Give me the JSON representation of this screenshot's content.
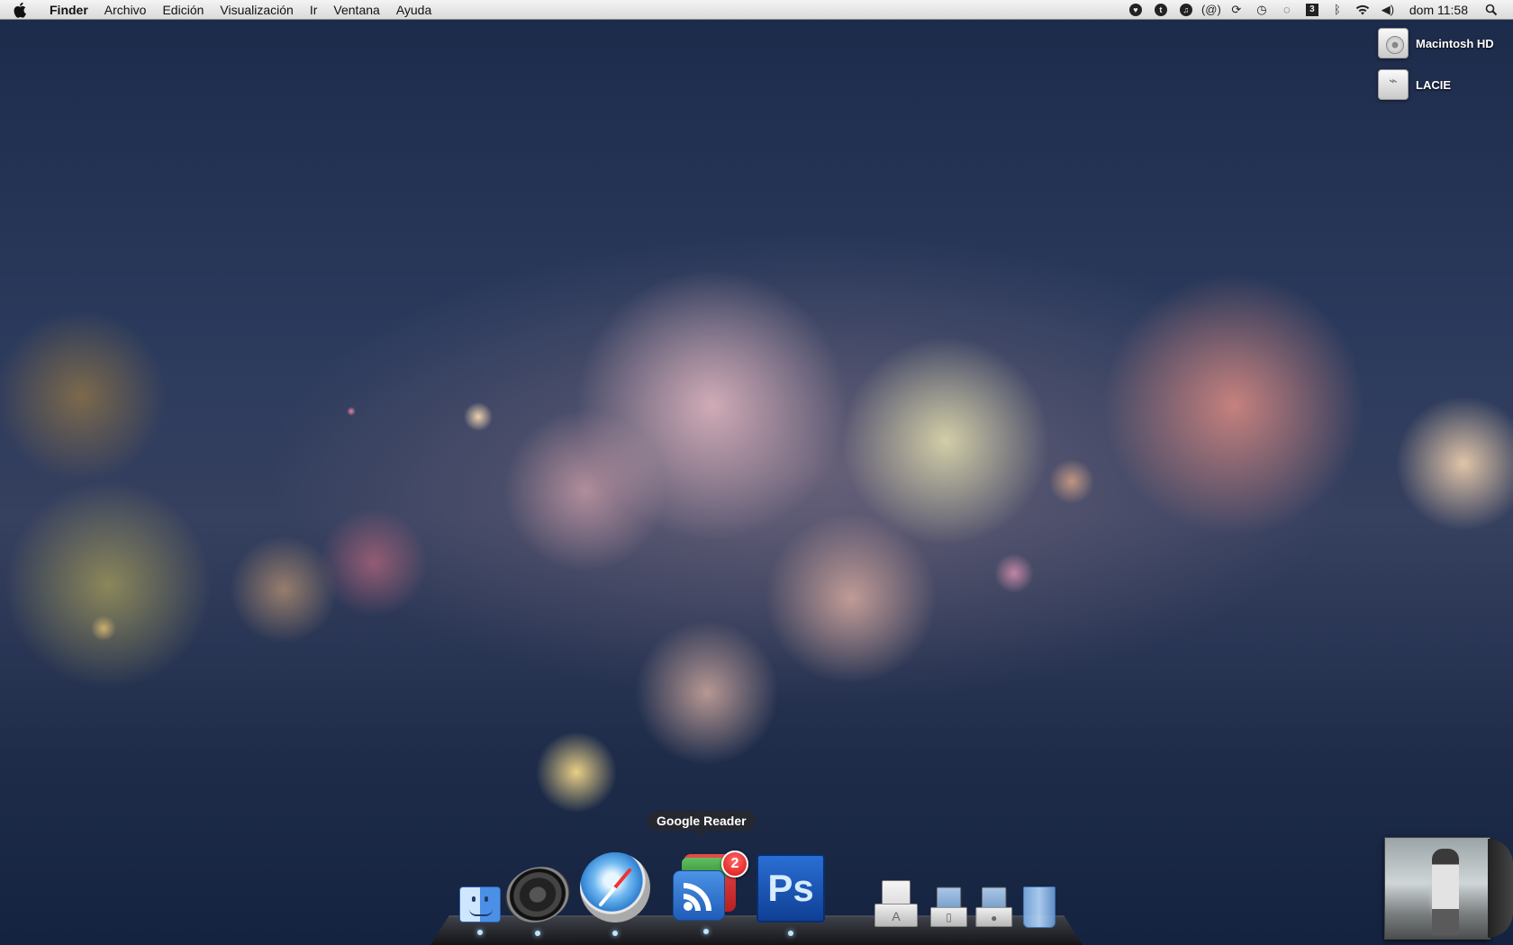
{
  "menubar": {
    "app_name": "Finder",
    "menus": [
      "Archivo",
      "Edición",
      "Visualización",
      "Ir",
      "Ventana",
      "Ayuda"
    ],
    "status_icons": [
      "heart-icon",
      "twitter-icon",
      "itunes-icon",
      "at-icon",
      "sync-icon",
      "time-machine-icon",
      "speech-bubble-icon",
      "battery-3-icon",
      "bluetooth-icon",
      "wifi-icon",
      "volume-icon",
      "spotlight-icon"
    ],
    "status_badge_text": "3",
    "clock": "dom 11:58"
  },
  "desktop": {
    "drives": [
      {
        "label": "Macintosh HD",
        "icon": "hard-drive-icon"
      },
      {
        "label": "LACIE",
        "icon": "usb-drive-icon"
      }
    ]
  },
  "dock": {
    "tooltip": "Google Reader",
    "apps": [
      {
        "name": "Finder",
        "icon": "finder-icon"
      },
      {
        "name": "Speaker",
        "icon": "speaker-icon"
      },
      {
        "name": "Safari",
        "icon": "safari-icon"
      },
      {
        "name": "Google Reader",
        "icon": "rss-reader-icon",
        "badge": "2",
        "ps_label": ""
      },
      {
        "name": "Photoshop",
        "icon": "photoshop-icon",
        "label": "Ps"
      }
    ],
    "stacks": [
      {
        "name": "Applications",
        "icon": "applications-stack-icon"
      },
      {
        "name": "Documents",
        "icon": "documents-stack-icon"
      },
      {
        "name": "Downloads",
        "icon": "downloads-stack-icon"
      },
      {
        "name": "Trash",
        "icon": "trash-icon"
      }
    ]
  },
  "now_playing": {
    "icon": "album-art-icon"
  },
  "colors": {
    "menubar": "#e6e6e6",
    "badge": "#d81010",
    "photoshop": "#1f5db8"
  }
}
